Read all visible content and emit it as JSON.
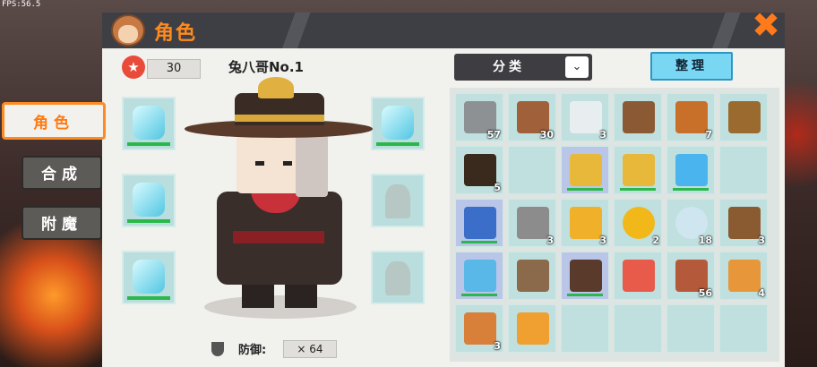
{
  "fps": "FPS:56.5",
  "title": "角色",
  "close": "✖",
  "tabs": [
    {
      "label": "角色",
      "active": true
    },
    {
      "label": "合成",
      "active": false
    },
    {
      "label": "附魔",
      "active": false
    }
  ],
  "character": {
    "level": "30",
    "name": "兔八哥No.1",
    "defense_label": "防御:",
    "defense_value": "× 64"
  },
  "equipment_left": [
    "ice-helmet",
    "ice-chestplate",
    "ice-leggings"
  ],
  "equipment_right": [
    "ice-boots",
    "empty-cape-slot",
    "empty-mount-slot"
  ],
  "sort_label": "分类",
  "tidy_label": "整理",
  "inventory": [
    [
      {
        "icon": "stone-block",
        "count": "57"
      },
      {
        "icon": "wood-block",
        "count": "30"
      },
      {
        "icon": "string",
        "count": "3"
      },
      {
        "icon": "crafting-table",
        "count": ""
      },
      {
        "icon": "torch",
        "count": "7"
      },
      {
        "icon": "barrel",
        "count": ""
      }
    ],
    [
      {
        "icon": "dark-block",
        "count": "5"
      },
      {
        "icon": "empty",
        "count": ""
      },
      {
        "icon": "gold-shovel",
        "count": ""
      },
      {
        "icon": "gold-shovel",
        "count": ""
      },
      {
        "icon": "diamond-shovel",
        "count": ""
      },
      {
        "icon": "empty",
        "count": ""
      }
    ],
    [
      {
        "icon": "wrench",
        "count": ""
      },
      {
        "icon": "stone-ore",
        "count": "3"
      },
      {
        "icon": "gold-ingot",
        "count": "3"
      },
      {
        "icon": "gold-coin",
        "count": "2"
      },
      {
        "icon": "winged-orb",
        "count": "18"
      },
      {
        "icon": "stick",
        "count": "3"
      }
    ],
    [
      {
        "icon": "ice-sword",
        "count": ""
      },
      {
        "icon": "bow",
        "count": ""
      },
      {
        "icon": "dark-bow",
        "count": ""
      },
      {
        "icon": "armor-vest",
        "count": ""
      },
      {
        "icon": "steak",
        "count": "56"
      },
      {
        "icon": "bread",
        "count": "4"
      }
    ],
    [
      {
        "icon": "burger",
        "count": "3"
      },
      {
        "icon": "rocket",
        "count": ""
      },
      {
        "icon": "empty",
        "count": ""
      },
      {
        "icon": "empty",
        "count": ""
      },
      {
        "icon": "empty",
        "count": ""
      },
      {
        "icon": "empty",
        "count": ""
      }
    ]
  ]
}
